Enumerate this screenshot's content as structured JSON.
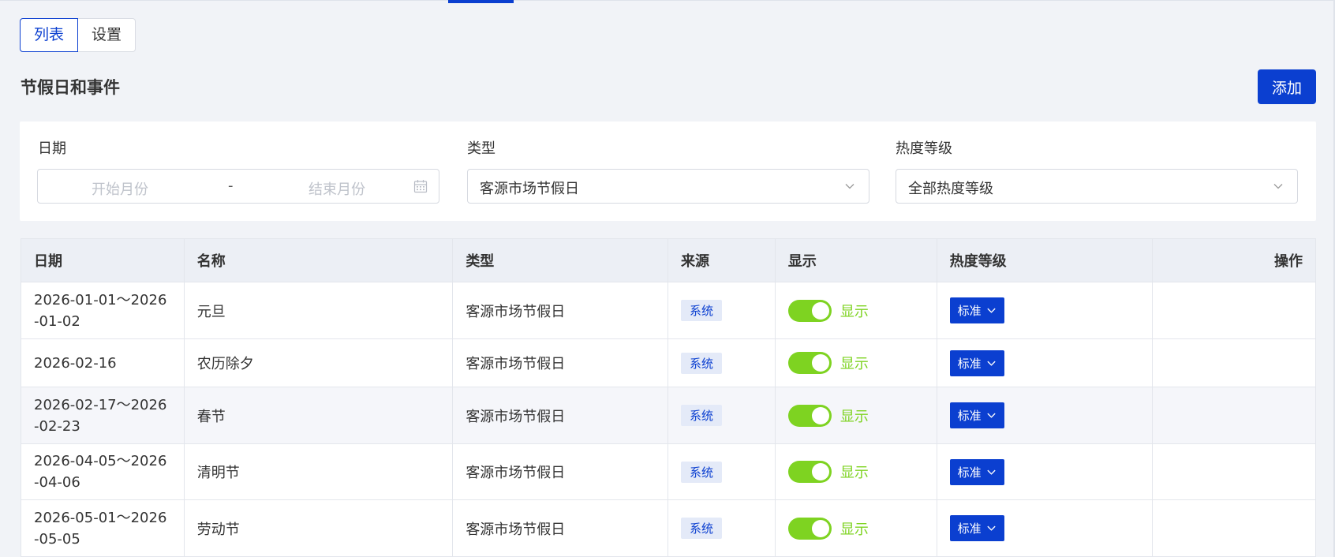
{
  "view_tabs": [
    {
      "label": "列表",
      "active": true
    },
    {
      "label": "设置",
      "active": false
    }
  ],
  "page_title": "节假日和事件",
  "add_button": "添加",
  "filters": {
    "date": {
      "label": "日期",
      "start_placeholder": "开始月份",
      "separator": "-",
      "end_placeholder": "结束月份"
    },
    "type": {
      "label": "类型",
      "value": "客源市场节假日"
    },
    "heat": {
      "label": "热度等级",
      "value": "全部热度等级"
    }
  },
  "table": {
    "columns": [
      "日期",
      "名称",
      "类型",
      "来源",
      "显示",
      "热度等级",
      "操作"
    ],
    "rows": [
      {
        "date": "2026-01-01～2026-01-02",
        "name": "元旦",
        "type": "客源市场节假日",
        "source": "系统",
        "display": "显示",
        "heat": "标准"
      },
      {
        "date": "2026-02-16",
        "name": "农历除夕",
        "type": "客源市场节假日",
        "source": "系统",
        "display": "显示",
        "heat": "标准"
      },
      {
        "date": "2026-02-17～2026-02-23",
        "name": "春节",
        "type": "客源市场节假日",
        "source": "系统",
        "display": "显示",
        "heat": "标准"
      },
      {
        "date": "2026-04-05～2026-04-06",
        "name": "清明节",
        "type": "客源市场节假日",
        "source": "系统",
        "display": "显示",
        "heat": "标准"
      },
      {
        "date": "2026-05-01～2026-05-05",
        "name": "劳动节",
        "type": "客源市场节假日",
        "source": "系统",
        "display": "显示",
        "heat": "标准"
      }
    ]
  },
  "colors": {
    "accent": "#0b3fd0",
    "toggle_on": "#7ed321",
    "badge_bg": "#e4eaf8",
    "page_bg": "#f1f3f7"
  },
  "icons": {
    "date_picker": "calendar-icon",
    "select": "chevron-down-icon"
  }
}
